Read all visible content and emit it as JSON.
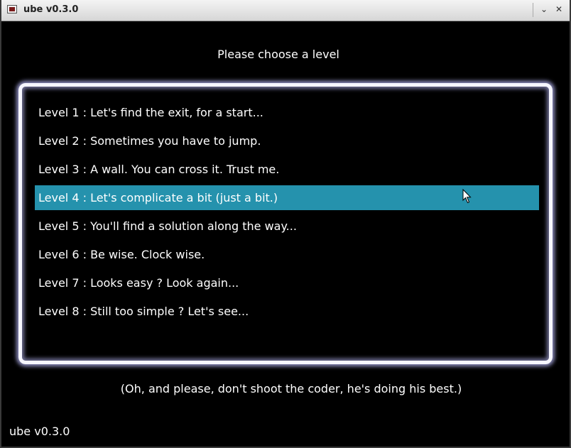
{
  "window": {
    "title": "ube v0.3.0",
    "minimize_glyph": "⌄",
    "close_glyph": "✕"
  },
  "heading": "Please choose a level",
  "levels": [
    {
      "label": "Level 1 : Let's find the exit, for a start..."
    },
    {
      "label": "Level 2 : Sometimes you have to jump."
    },
    {
      "label": "Level 3 : A wall. You can cross it. Trust me."
    },
    {
      "label": "Level 4 : Let's complicate a bit (just a bit.)"
    },
    {
      "label": "Level 5 : You'll find a solution along the way..."
    },
    {
      "label": "Level 6 : Be wise. Clock wise."
    },
    {
      "label": "Level 7 : Looks easy ? Look again..."
    },
    {
      "label": "Level 8 : Still too simple ? Let's see..."
    }
  ],
  "selected_level_index": 3,
  "footer_note": "(Oh, and please, don't shoot the coder, he's doing his best.)",
  "version": "ube v0.3.0",
  "colors": {
    "background": "#000000",
    "highlight": "#2592ad",
    "text": "#ffffff",
    "frame": "#f6f6ff"
  },
  "icons": {
    "app": "app-icon",
    "minimize": "chevron-down-icon",
    "close": "close-icon",
    "cursor": "mouse-pointer-icon"
  }
}
